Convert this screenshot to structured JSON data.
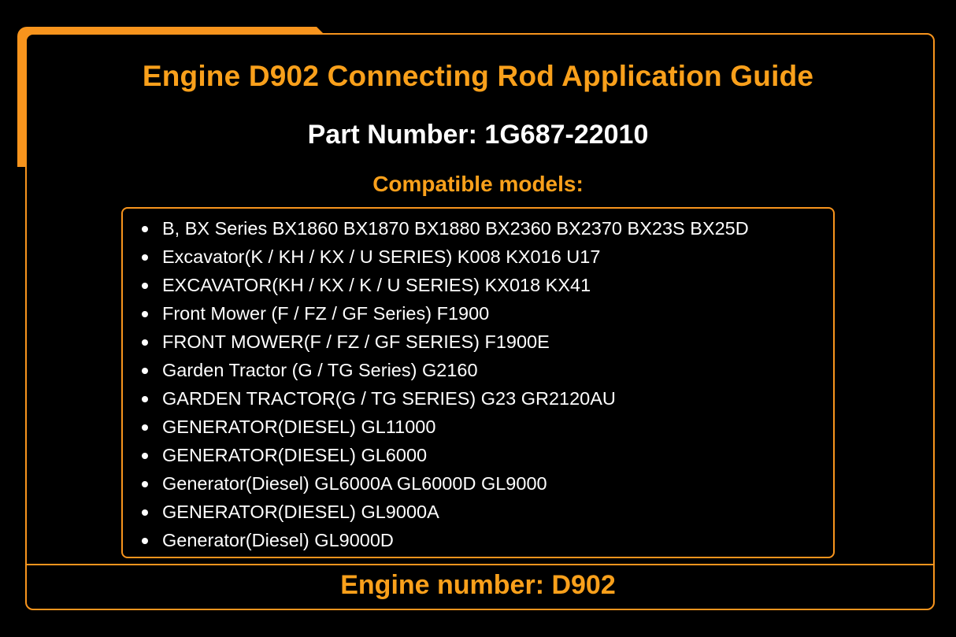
{
  "title": "Engine D902 Connecting Rod Application Guide",
  "part_number": "Part Number: 1G687-22010",
  "compatible_heading": "Compatible models:",
  "models": [
    "B, BX Series BX1860 BX1870 BX1880 BX2360 BX2370 BX23S BX25D",
    "Excavator(K / KH / KX / U SERIES) K008 KX016 U17",
    "EXCAVATOR(KH / KX / K / U SERIES) KX018 KX41",
    "Front Mower (F / FZ / GF Series) F1900",
    "FRONT MOWER(F / FZ / GF SERIES) F1900E",
    "Garden Tractor (G / TG Series) G2160",
    "GARDEN TRACTOR(G / TG SERIES) G23 GR2120AU",
    "GENERATOR(DIESEL) GL11000",
    "GENERATOR(DIESEL) GL6000",
    "Generator(Diesel) GL6000A GL6000D GL9000",
    "GENERATOR(DIESEL) GL9000A",
    "Generator(Diesel) GL9000D"
  ],
  "engine_number": "Engine number: D902",
  "colors": {
    "accent": "#f7941d",
    "heading": "#f9a01b",
    "background": "#000000",
    "text": "#ffffff"
  }
}
